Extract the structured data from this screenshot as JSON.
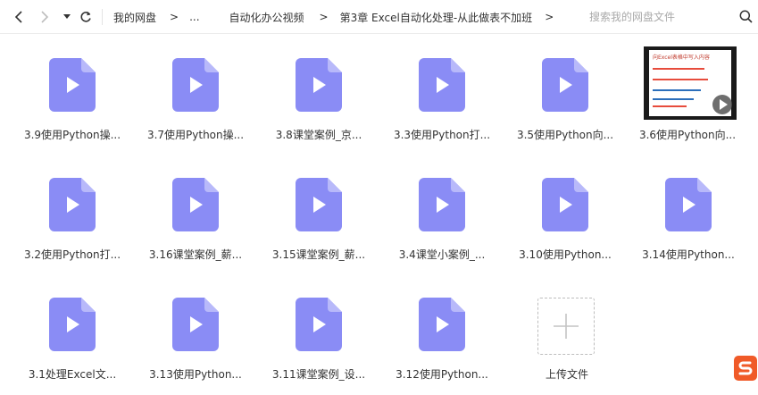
{
  "nav": {
    "back_icon": "back-arrow-icon",
    "forward_icon": "forward-arrow-icon",
    "history_icon": "dropdown-caret-icon",
    "refresh_icon": "refresh-icon"
  },
  "breadcrumb": {
    "items": [
      "我的网盘",
      "...",
      "自动化办公视频",
      "第3章 Excel自动化处理-从此做表不加班"
    ],
    "separator": ">"
  },
  "search": {
    "placeholder": "搜索我的网盘文件",
    "icon": "search-icon"
  },
  "files": [
    {
      "name": "3.9使用Python操...",
      "type": "video"
    },
    {
      "name": "3.7使用Python操...",
      "type": "video"
    },
    {
      "name": "3.8课堂案例_京...",
      "type": "video"
    },
    {
      "name": "3.3使用Python打...",
      "type": "video"
    },
    {
      "name": "3.5使用Python向...",
      "type": "video"
    },
    {
      "name": "3.6使用Python向...",
      "type": "video-thumbnail",
      "thumbnail_text": [
        "向Excel表格中写入内容"
      ]
    },
    {
      "name": "3.2使用Python打...",
      "type": "video"
    },
    {
      "name": "3.16课堂案例_薪...",
      "type": "video"
    },
    {
      "name": "3.15课堂案例_薪...",
      "type": "video"
    },
    {
      "name": "3.4课堂小案例_...",
      "type": "video"
    },
    {
      "name": "3.10使用Python...",
      "type": "video"
    },
    {
      "name": "3.14使用Python...",
      "type": "video"
    },
    {
      "name": "3.1处理Excel文...",
      "type": "video"
    },
    {
      "name": "3.13使用Python...",
      "type": "video"
    },
    {
      "name": "3.11课堂案例_设...",
      "type": "video"
    },
    {
      "name": "3.12使用Python...",
      "type": "video"
    }
  ],
  "upload": {
    "label": "上传文件",
    "icon": "plus-icon"
  },
  "colors": {
    "video_icon": "#8a8cf5",
    "video_icon_fold": "#b8b9fa",
    "logo": "#f05a28"
  }
}
